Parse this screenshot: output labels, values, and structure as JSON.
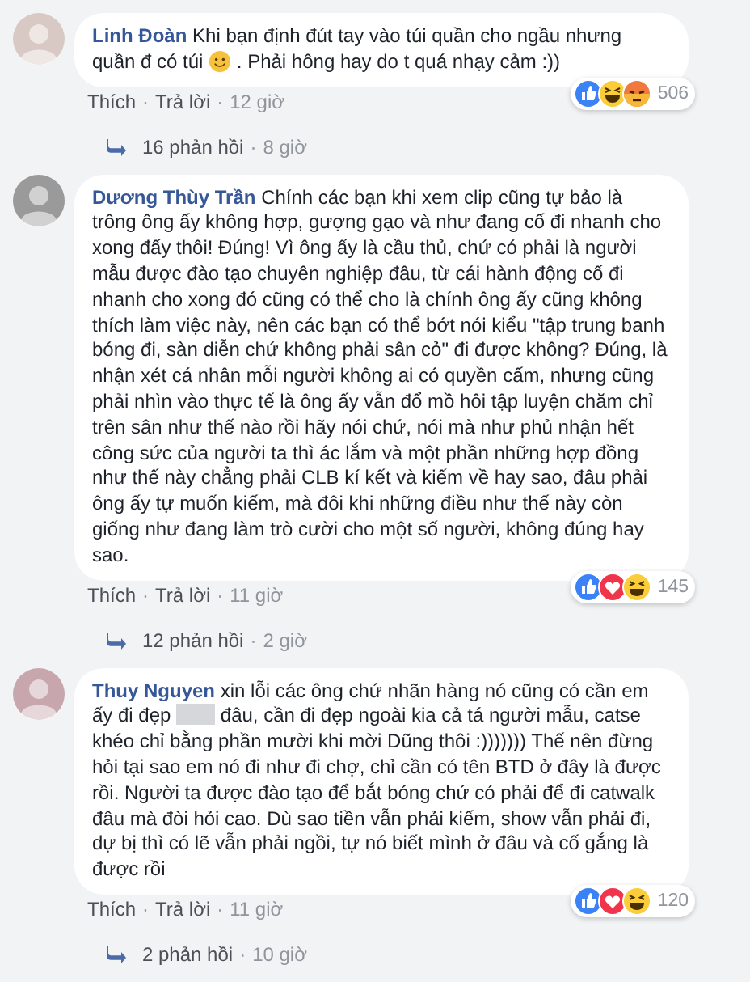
{
  "comments": [
    {
      "author": "Linh Đoàn",
      "body": [
        {
          "kind": "text",
          "text": "Khi bạn định đút tay vào túi quần cho ngầu nhưng quần đ có túi"
        },
        {
          "kind": "emoji"
        },
        {
          "kind": "text",
          "text": ". Phải hông hay do t quá nhạy cảm :))"
        }
      ],
      "actions": [
        {
          "kind": "link",
          "text": "Thích"
        },
        {
          "kind": "separator",
          "text": "·"
        },
        {
          "kind": "link",
          "text": "Trả lời"
        },
        {
          "kind": "separator",
          "text": "·"
        },
        {
          "kind": "time",
          "text": "12 giờ"
        }
      ],
      "reactions": [
        {
          "kind": "like"
        },
        {
          "kind": "haha"
        },
        {
          "kind": "angry"
        }
      ],
      "reaction_count": "506",
      "replies": [
        {
          "kind": "link",
          "text": "16 phản hồi"
        },
        {
          "kind": "separator",
          "text": "·"
        },
        {
          "kind": "time",
          "text": "8 giờ"
        }
      ]
    },
    {
      "author": "Dương Thùy Trần",
      "body": [
        {
          "kind": "text",
          "text": "Chính các bạn khi xem clip cũng tự bảo là trông ông ấy không hợp, gượng gạo và như đang cố đi nhanh cho xong đấy thôi! Đúng! Vì ông ấy là cầu thủ, chứ có phải là người mẫu được đào tạo chuyên nghiệp đâu, từ cái hành động cố đi nhanh cho xong đó cũng có thể cho là chính ông ấy cũng không thích làm việc này, nên các bạn có thể bớt nói kiểu \"tập trung banh bóng đi, sàn diễn chứ không phải sân cỏ\" đi được không? Đúng, là nhận xét cá nhân mỗi người không ai có quyền cấm, nhưng cũng phải nhìn vào thực tế là ông ấy vẫn đổ mồ hôi tập luyện chăm chỉ trên sân như thế nào rồi hãy nói chứ, nói mà như phủ nhận hết công sức của người ta thì ác lắm và một phần những hợp đồng như thế này chẳng phải CLB kí kết và kiếm về hay sao, đâu phải ông ấy tự muốn kiếm, mà đôi khi những điều như thế này còn giống như đang làm trò cười cho một số người, không đúng hay sao."
        }
      ],
      "actions": [
        {
          "kind": "link",
          "text": "Thích"
        },
        {
          "kind": "separator",
          "text": "·"
        },
        {
          "kind": "link",
          "text": "Trả lời"
        },
        {
          "kind": "separator",
          "text": "·"
        },
        {
          "kind": "time",
          "text": "11 giờ"
        }
      ],
      "reactions": [
        {
          "kind": "like"
        },
        {
          "kind": "love"
        },
        {
          "kind": "haha"
        }
      ],
      "reaction_count": "145",
      "replies": [
        {
          "kind": "link",
          "text": "12 phản hồi"
        },
        {
          "kind": "separator",
          "text": "·"
        },
        {
          "kind": "time",
          "text": "2 giờ"
        }
      ]
    },
    {
      "author": "Thuy Nguyen",
      "body": [
        {
          "kind": "text",
          "text": "xin lỗi các ông chứ nhãn hàng nó cũng có cần em ấy đi đẹp"
        },
        {
          "kind": "redacted"
        },
        {
          "kind": "text",
          "text": "đâu, cần đi đẹp ngoài kia cả tá người mẫu, catse khéo chỉ bằng phần mười khi mời Dũng thôi :))))))) Thế nên đừng hỏi tại sao em nó đi như đi chợ, chỉ cần có tên BTD ở đây là được rồi. Người ta được đào tạo để bắt bóng chứ có phải để đi catwalk đâu mà đòi hỏi cao. Dù sao tiền vẫn phải kiếm, show vẫn phải đi, dự bị thì có lẽ vẫn phải ngồi, tự nó biết mình ở đâu và cố gắng là được rồi"
        }
      ],
      "actions": [
        {
          "kind": "link",
          "text": "Thích"
        },
        {
          "kind": "separator",
          "text": "·"
        },
        {
          "kind": "link",
          "text": "Trả lời"
        },
        {
          "kind": "separator",
          "text": "·"
        },
        {
          "kind": "time",
          "text": "11 giờ"
        }
      ],
      "reactions": [
        {
          "kind": "like"
        },
        {
          "kind": "love"
        },
        {
          "kind": "haha"
        }
      ],
      "reaction_count": "120",
      "replies": [
        {
          "kind": "link",
          "text": "2 phản hồi"
        },
        {
          "kind": "separator",
          "text": "·"
        },
        {
          "kind": "time",
          "text": "10 giờ"
        }
      ]
    }
  ]
}
